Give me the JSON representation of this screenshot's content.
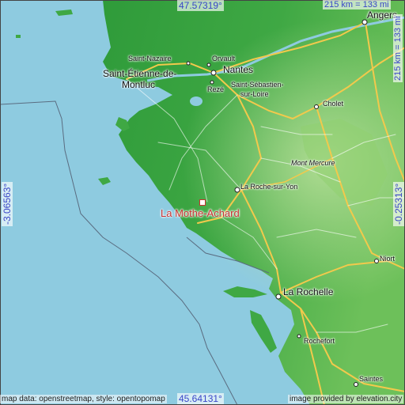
{
  "coordinates": {
    "north": "47.57319°",
    "south": "45.64131°",
    "west": "-3.06563°",
    "east": "-0.25313°"
  },
  "scale": {
    "horizontal": "215 km = 133 mi",
    "vertical": "215 km = 133 mi"
  },
  "center_label": "La Mothe-Achard",
  "places": {
    "angers": "Angers",
    "saint_nazaire": "Saint-Nazaire",
    "orvault": "Orvault",
    "saint_etienne_1": "Saint-Étienne-de-",
    "saint_etienne_2": "Montluc",
    "nantes": "Nantes",
    "reze": "Rezé",
    "saint_sebastien_1": "Saint-Sébastien-",
    "saint_sebastien_2": "sur-Loire",
    "cholet": "Cholet",
    "mont_mercure": "Mont Mercure",
    "la_roche": "La Roche-sur-Yon",
    "niort": "Niort",
    "la_rochelle": "La Rochelle",
    "rochefort": "Rochefort",
    "saintes": "Saintes"
  },
  "footer": {
    "left": "map data: openstreetmap, style: opentopomap",
    "right": "image provided by elevation.city"
  },
  "colors": {
    "sea": "#8ecbe0",
    "land_low": "#2f9b3a",
    "land_mid": "#56b84a",
    "land_high": "#a9d98a",
    "road_major": "#f2c94c",
    "accent": "#c83232",
    "coord_text": "#3a46c8"
  }
}
